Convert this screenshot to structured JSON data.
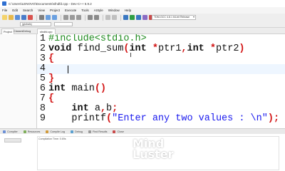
{
  "window": {
    "title": "C:\\Users\\LENOVO\\Documents\\sfndfd.cpp - Dev-C++ 5.9.2"
  },
  "menu": [
    "File",
    "Edit",
    "Search",
    "View",
    "Project",
    "Execute",
    "Tools",
    "AStyle",
    "Window",
    "Help"
  ],
  "toolbar": {
    "compiler": "TDM-GCC 4.8.1 64-bit Release",
    "globals": "(globals)"
  },
  "tabs": {
    "project": "Project",
    "classes": "Classes",
    "debug": "Debug",
    "file": "sfndfd.cpp"
  },
  "code": [
    {
      "n": "1",
      "parts": [
        [
          "pp",
          "#include<stdio.h>"
        ]
      ]
    },
    {
      "n": "2",
      "parts": [
        [
          "ty",
          "void"
        ],
        [
          "id",
          " find_sum"
        ],
        [
          "sym",
          "("
        ],
        [
          "ty",
          "int"
        ],
        [
          "id",
          " "
        ],
        [
          "sym",
          "*"
        ],
        [
          "id",
          "ptr1"
        ],
        [
          "sym",
          ","
        ],
        [
          "ty",
          "int"
        ],
        [
          "id",
          " "
        ],
        [
          "sym",
          "*"
        ],
        [
          "id",
          "ptr2"
        ],
        [
          "sym",
          ")"
        ]
      ]
    },
    {
      "n": "3",
      "parts": [
        [
          "sym",
          "{"
        ]
      ]
    },
    {
      "n": "4",
      "parts": []
    },
    {
      "n": "5",
      "parts": [
        [
          "sym",
          "}"
        ]
      ]
    },
    {
      "n": "6",
      "parts": [
        [
          "ty",
          "int"
        ],
        [
          "id",
          " main"
        ],
        [
          "sym",
          "()"
        ]
      ]
    },
    {
      "n": "7",
      "parts": [
        [
          "sym",
          "{"
        ]
      ]
    },
    {
      "n": "8",
      "parts": [
        [
          "id",
          "    "
        ],
        [
          "ty",
          "int"
        ],
        [
          "id",
          " a"
        ],
        [
          "sym",
          ","
        ],
        [
          "id",
          "b"
        ],
        [
          "sym",
          ";"
        ]
      ]
    },
    {
      "n": "9",
      "parts": [
        [
          "id",
          "    printf"
        ],
        [
          "sym",
          "("
        ],
        [
          "str",
          "\"Enter any two values : \\n\""
        ],
        [
          "sym",
          ");"
        ]
      ]
    }
  ],
  "bottom_tabs": [
    "Compiler",
    "Resources",
    "Compile Log",
    "Debug",
    "Find Results",
    "Close"
  ],
  "log": {
    "line1": "Compilation Time: 0.69s"
  },
  "watermark": {
    "line1": "Mind",
    "line2": "Luster"
  },
  "colors": {
    "accent": "#2e6fd1",
    "symbol": "#d21414",
    "preprocessor": "#1f8a1f",
    "string": "#1a1aee"
  }
}
